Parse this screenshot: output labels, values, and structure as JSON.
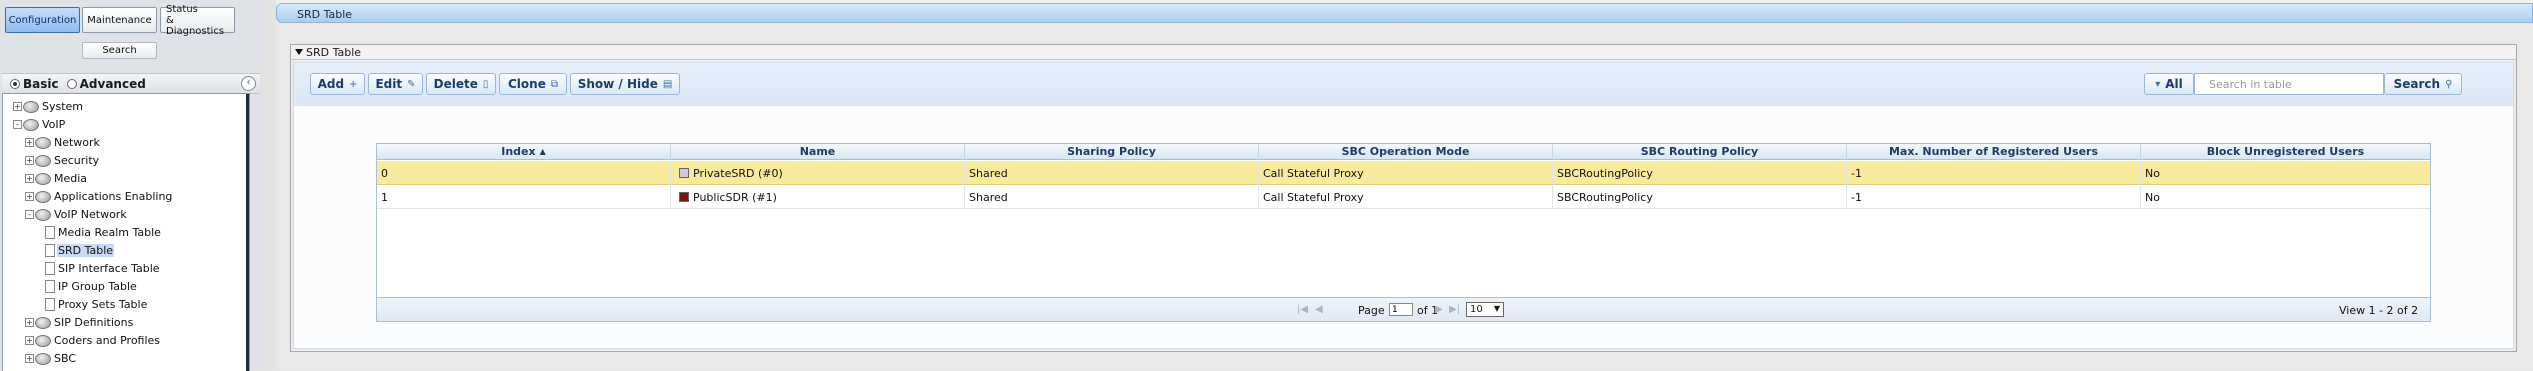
{
  "nav": {
    "top_buttons": {
      "configuration": "Configuration",
      "maintenance": "Maintenance",
      "status": "Status\n& Diagnostics",
      "search": "Search"
    },
    "mode": {
      "basic": "Basic",
      "advanced": "Advanced",
      "selected": "Basic"
    },
    "tree": [
      {
        "label": "System",
        "expander": "+"
      },
      {
        "label": "VoIP",
        "expander": "-"
      },
      {
        "label": "Network",
        "expander": "+"
      },
      {
        "label": "Security",
        "expander": "+"
      },
      {
        "label": "Media",
        "expander": "+"
      },
      {
        "label": "Applications Enabling",
        "expander": "+"
      },
      {
        "label": "VoIP Network",
        "expander": "-"
      },
      {
        "label": "Media Realm Table"
      },
      {
        "label": "SRD Table",
        "selected": true
      },
      {
        "label": "SIP Interface Table"
      },
      {
        "label": "IP Group Table"
      },
      {
        "label": "Proxy Sets Table"
      },
      {
        "label": "SIP Definitions",
        "expander": "+"
      },
      {
        "label": "Coders and Profiles",
        "expander": "+"
      },
      {
        "label": "SBC",
        "expander": "+"
      }
    ]
  },
  "page": {
    "title": "SRD Table",
    "section_title": "SRD Table"
  },
  "toolbar": {
    "add": "Add",
    "edit": "Edit",
    "delete": "Delete",
    "clone": "Clone",
    "show_hide": "Show / Hide",
    "all": "All",
    "search_placeholder": "Search in table",
    "search": "Search"
  },
  "table": {
    "columns": [
      "Index",
      "Name",
      "Sharing Policy",
      "SBC Operation Mode",
      "SBC Routing Policy",
      "Max. Number of Registered Users",
      "Block Unregistered Users"
    ],
    "sort_column": "Index",
    "rows": [
      {
        "index": "0",
        "name": "PrivateSRD (#0)",
        "color": "#c9cbd6",
        "sharing": "Shared",
        "mode": "Call Stateful Proxy",
        "routing": "SBCRoutingPolicy",
        "max_users": "-1",
        "block": "No",
        "selected": true
      },
      {
        "index": "1",
        "name": "PublicSDR (#1)",
        "color": "#7a1616",
        "sharing": "Shared",
        "mode": "Call Stateful Proxy",
        "routing": "SBCRoutingPolicy",
        "max_users": "-1",
        "block": "No",
        "selected": false
      }
    ]
  },
  "pager": {
    "page_label": "Page",
    "current_page": "1",
    "of_label": "of 1",
    "rows_per_page": "10",
    "view": "View 1 - 2 of 2"
  },
  "colors": {
    "accent": "#a9ccf1",
    "selected_row": "#f8eb9d",
    "active_tab": "#8cbcf0"
  }
}
